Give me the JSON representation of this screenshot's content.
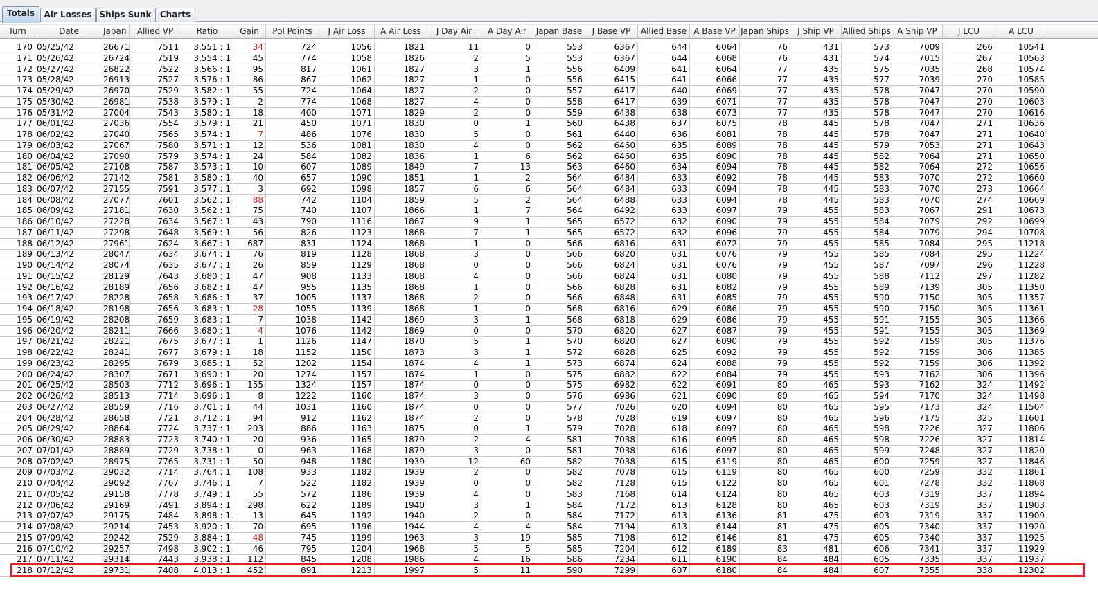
{
  "tabs": [
    {
      "label": "Totals",
      "active": true
    },
    {
      "label": "Air Losses",
      "active": false
    },
    {
      "label": "Ships Sunk",
      "active": false
    },
    {
      "label": "Charts",
      "active": false
    }
  ],
  "columns": [
    "Turn",
    "Date",
    "Japan VP",
    "Allied VP",
    "Ratio",
    "Gain",
    "Pol Points",
    "J Air Loss",
    "A Air Loss",
    "J Day Air",
    "A Day Air",
    "Japan Base",
    "J Base VP",
    "Allied Base",
    "A Base VP",
    "Japan Ships",
    "J Ship VP",
    "Allied Ships",
    "A Ship VP",
    "J LCU",
    "A LCU"
  ],
  "colors": {
    "gain_negative": "#d81b1b",
    "highlight": "#e0202a"
  },
  "rows": [
    [
      "170",
      "05/25/42",
      "26671",
      "7511",
      "3,551 : 1",
      "34",
      "724",
      "1056",
      "1821",
      "11",
      "0",
      "553",
      "6367",
      "644",
      "6064",
      "76",
      "431",
      "573",
      "7009",
      "266",
      "10541"
    ],
    [
      "171",
      "05/26/42",
      "26724",
      "7519",
      "3,554 : 1",
      "45",
      "774",
      "1058",
      "1826",
      "2",
      "5",
      "553",
      "6367",
      "644",
      "6068",
      "76",
      "431",
      "574",
      "7015",
      "267",
      "10563"
    ],
    [
      "172",
      "05/27/42",
      "26822",
      "7522",
      "3,566 : 1",
      "95",
      "817",
      "1061",
      "1827",
      "3",
      "1",
      "556",
      "6409",
      "641",
      "6064",
      "77",
      "435",
      "575",
      "7035",
      "268",
      "10574"
    ],
    [
      "173",
      "05/28/42",
      "26913",
      "7527",
      "3,576 : 1",
      "86",
      "867",
      "1062",
      "1827",
      "1",
      "0",
      "556",
      "6415",
      "641",
      "6066",
      "77",
      "435",
      "577",
      "7039",
      "270",
      "10585"
    ],
    [
      "174",
      "05/29/42",
      "26970",
      "7529",
      "3,582 : 1",
      "55",
      "724",
      "1064",
      "1827",
      "2",
      "0",
      "557",
      "6417",
      "640",
      "6069",
      "77",
      "435",
      "578",
      "7047",
      "270",
      "10590"
    ],
    [
      "175",
      "05/30/42",
      "26981",
      "7538",
      "3,579 : 1",
      "2",
      "774",
      "1068",
      "1827",
      "4",
      "0",
      "558",
      "6417",
      "639",
      "6071",
      "77",
      "435",
      "578",
      "7047",
      "270",
      "10603"
    ],
    [
      "176",
      "05/31/42",
      "27004",
      "7543",
      "3,580 : 1",
      "18",
      "400",
      "1071",
      "1829",
      "2",
      "0",
      "559",
      "6438",
      "638",
      "6073",
      "77",
      "435",
      "578",
      "7047",
      "270",
      "10616"
    ],
    [
      "177",
      "06/01/42",
      "27036",
      "7554",
      "3,579 : 1",
      "21",
      "450",
      "1071",
      "1830",
      "0",
      "1",
      "560",
      "6438",
      "637",
      "6075",
      "78",
      "445",
      "578",
      "7047",
      "271",
      "10636"
    ],
    [
      "178",
      "06/02/42",
      "27040",
      "7565",
      "3,574 : 1",
      "7",
      "486",
      "1076",
      "1830",
      "5",
      "0",
      "561",
      "6440",
      "636",
      "6081",
      "78",
      "445",
      "578",
      "7047",
      "271",
      "10640"
    ],
    [
      "179",
      "06/03/42",
      "27067",
      "7580",
      "3,571 : 1",
      "12",
      "536",
      "1081",
      "1830",
      "4",
      "0",
      "562",
      "6460",
      "635",
      "6089",
      "78",
      "445",
      "579",
      "7053",
      "271",
      "10643"
    ],
    [
      "180",
      "06/04/42",
      "27090",
      "7579",
      "3,574 : 1",
      "24",
      "584",
      "1082",
      "1836",
      "1",
      "6",
      "562",
      "6460",
      "635",
      "6090",
      "78",
      "445",
      "582",
      "7064",
      "271",
      "10650"
    ],
    [
      "181",
      "06/05/42",
      "27108",
      "7587",
      "3,573 : 1",
      "10",
      "607",
      "1089",
      "1849",
      "7",
      "13",
      "563",
      "6460",
      "634",
      "6094",
      "78",
      "445",
      "582",
      "7064",
      "272",
      "10656"
    ],
    [
      "182",
      "06/06/42",
      "27142",
      "7581",
      "3,580 : 1",
      "40",
      "657",
      "1090",
      "1851",
      "1",
      "2",
      "564",
      "6484",
      "633",
      "6092",
      "78",
      "445",
      "583",
      "7070",
      "272",
      "10660"
    ],
    [
      "183",
      "06/07/42",
      "27155",
      "7591",
      "3,577 : 1",
      "3",
      "692",
      "1098",
      "1857",
      "6",
      "6",
      "564",
      "6484",
      "633",
      "6094",
      "78",
      "445",
      "583",
      "7070",
      "273",
      "10664"
    ],
    [
      "184",
      "06/08/42",
      "27077",
      "7601",
      "3,562 : 1",
      "88",
      "742",
      "1104",
      "1859",
      "5",
      "2",
      "564",
      "6488",
      "633",
      "6094",
      "78",
      "445",
      "583",
      "7070",
      "274",
      "10669"
    ],
    [
      "185",
      "06/09/42",
      "27181",
      "7630",
      "3,562 : 1",
      "75",
      "740",
      "1107",
      "1866",
      "1",
      "7",
      "564",
      "6492",
      "633",
      "6097",
      "79",
      "455",
      "583",
      "7067",
      "291",
      "10673"
    ],
    [
      "186",
      "06/10/42",
      "27228",
      "7634",
      "3,567 : 1",
      "43",
      "790",
      "1116",
      "1867",
      "9",
      "1",
      "565",
      "6572",
      "632",
      "6090",
      "79",
      "455",
      "584",
      "7079",
      "292",
      "10699"
    ],
    [
      "187",
      "06/11/42",
      "27298",
      "7648",
      "3,569 : 1",
      "56",
      "826",
      "1123",
      "1868",
      "7",
      "1",
      "565",
      "6572",
      "632",
      "6096",
      "79",
      "455",
      "584",
      "7079",
      "294",
      "10708"
    ],
    [
      "188",
      "06/12/42",
      "27961",
      "7624",
      "3,667 : 1",
      "687",
      "831",
      "1124",
      "1868",
      "1",
      "0",
      "566",
      "6816",
      "631",
      "6072",
      "79",
      "455",
      "585",
      "7084",
      "295",
      "11218"
    ],
    [
      "189",
      "06/13/42",
      "28047",
      "7634",
      "3,674 : 1",
      "76",
      "819",
      "1128",
      "1868",
      "3",
      "0",
      "566",
      "6820",
      "631",
      "6076",
      "79",
      "455",
      "585",
      "7084",
      "295",
      "11224"
    ],
    [
      "190",
      "06/14/42",
      "28074",
      "7635",
      "3,677 : 1",
      "26",
      "859",
      "1129",
      "1868",
      "0",
      "0",
      "566",
      "6824",
      "631",
      "6076",
      "79",
      "455",
      "587",
      "7097",
      "296",
      "11228"
    ],
    [
      "191",
      "06/15/42",
      "28129",
      "7643",
      "3,680 : 1",
      "47",
      "908",
      "1133",
      "1868",
      "4",
      "0",
      "566",
      "6824",
      "631",
      "6080",
      "79",
      "455",
      "588",
      "7112",
      "297",
      "11282"
    ],
    [
      "192",
      "06/16/42",
      "28189",
      "7656",
      "3,682 : 1",
      "47",
      "955",
      "1135",
      "1868",
      "1",
      "0",
      "566",
      "6828",
      "631",
      "6082",
      "79",
      "455",
      "589",
      "7139",
      "305",
      "11350"
    ],
    [
      "193",
      "06/17/42",
      "28228",
      "7658",
      "3,686 : 1",
      "37",
      "1005",
      "1137",
      "1868",
      "2",
      "0",
      "566",
      "6848",
      "631",
      "6085",
      "79",
      "455",
      "590",
      "7150",
      "305",
      "11357"
    ],
    [
      "194",
      "06/18/42",
      "28198",
      "7656",
      "3,683 : 1",
      "28",
      "1055",
      "1139",
      "1868",
      "1",
      "0",
      "568",
      "6816",
      "629",
      "6086",
      "79",
      "455",
      "590",
      "7150",
      "305",
      "11361"
    ],
    [
      "195",
      "06/19/42",
      "28208",
      "7659",
      "3,683 : 1",
      "7",
      "1038",
      "1142",
      "1869",
      "3",
      "1",
      "568",
      "6818",
      "629",
      "6086",
      "79",
      "455",
      "591",
      "7155",
      "305",
      "11366"
    ],
    [
      "196",
      "06/20/42",
      "28211",
      "7666",
      "3,680 : 1",
      "4",
      "1076",
      "1142",
      "1869",
      "0",
      "0",
      "570",
      "6820",
      "627",
      "6087",
      "79",
      "455",
      "591",
      "7155",
      "305",
      "11369"
    ],
    [
      "197",
      "06/21/42",
      "28221",
      "7675",
      "3,677 : 1",
      "1",
      "1126",
      "1147",
      "1870",
      "5",
      "1",
      "570",
      "6820",
      "627",
      "6090",
      "79",
      "455",
      "592",
      "7159",
      "305",
      "11376"
    ],
    [
      "198",
      "06/22/42",
      "28241",
      "7677",
      "3,679 : 1",
      "18",
      "1152",
      "1150",
      "1873",
      "3",
      "1",
      "572",
      "6828",
      "625",
      "6092",
      "79",
      "455",
      "592",
      "7159",
      "306",
      "11385"
    ],
    [
      "199",
      "06/23/42",
      "28295",
      "7679",
      "3,685 : 1",
      "52",
      "1202",
      "1154",
      "1874",
      "4",
      "1",
      "573",
      "6874",
      "624",
      "6088",
      "79",
      "455",
      "592",
      "7159",
      "306",
      "11392"
    ],
    [
      "200",
      "06/24/42",
      "28307",
      "7671",
      "3,690 : 1",
      "20",
      "1274",
      "1157",
      "1874",
      "1",
      "0",
      "575",
      "6882",
      "622",
      "6084",
      "79",
      "455",
      "593",
      "7162",
      "306",
      "11396"
    ],
    [
      "201",
      "06/25/42",
      "28503",
      "7712",
      "3,696 : 1",
      "155",
      "1324",
      "1157",
      "1874",
      "0",
      "0",
      "575",
      "6982",
      "622",
      "6091",
      "80",
      "465",
      "593",
      "7162",
      "324",
      "11492"
    ],
    [
      "202",
      "06/26/42",
      "28513",
      "7714",
      "3,696 : 1",
      "8",
      "1222",
      "1160",
      "1874",
      "3",
      "0",
      "576",
      "6986",
      "621",
      "6090",
      "80",
      "465",
      "594",
      "7170",
      "324",
      "11498"
    ],
    [
      "203",
      "06/27/42",
      "28559",
      "7716",
      "3,701 : 1",
      "44",
      "1031",
      "1160",
      "1874",
      "0",
      "0",
      "577",
      "7026",
      "620",
      "6094",
      "80",
      "465",
      "595",
      "7173",
      "324",
      "11504"
    ],
    [
      "204",
      "06/28/42",
      "28658",
      "7721",
      "3,712 : 1",
      "94",
      "912",
      "1162",
      "1874",
      "2",
      "0",
      "578",
      "7028",
      "619",
      "6097",
      "80",
      "465",
      "596",
      "7175",
      "325",
      "11601"
    ],
    [
      "205",
      "06/29/42",
      "28864",
      "7724",
      "3,737 : 1",
      "203",
      "886",
      "1163",
      "1875",
      "0",
      "1",
      "579",
      "7028",
      "618",
      "6097",
      "80",
      "465",
      "598",
      "7226",
      "327",
      "11806"
    ],
    [
      "206",
      "06/30/42",
      "28883",
      "7723",
      "3,740 : 1",
      "20",
      "936",
      "1165",
      "1879",
      "2",
      "4",
      "581",
      "7038",
      "616",
      "6095",
      "80",
      "465",
      "598",
      "7226",
      "327",
      "11814"
    ],
    [
      "207",
      "07/01/42",
      "28889",
      "7729",
      "3,738 : 1",
      "0",
      "963",
      "1168",
      "1879",
      "3",
      "0",
      "581",
      "7038",
      "616",
      "6097",
      "80",
      "465",
      "599",
      "7248",
      "327",
      "11820"
    ],
    [
      "208",
      "07/02/42",
      "28975",
      "7765",
      "3,731 : 1",
      "50",
      "948",
      "1180",
      "1939",
      "12",
      "60",
      "582",
      "7038",
      "615",
      "6119",
      "80",
      "465",
      "600",
      "7259",
      "327",
      "11846"
    ],
    [
      "209",
      "07/03/42",
      "29032",
      "7714",
      "3,764 : 1",
      "108",
      "933",
      "1182",
      "1939",
      "2",
      "0",
      "582",
      "7078",
      "615",
      "6119",
      "80",
      "465",
      "600",
      "7259",
      "332",
      "11861"
    ],
    [
      "210",
      "07/04/42",
      "29092",
      "7767",
      "3,746 : 1",
      "7",
      "522",
      "1182",
      "1939",
      "0",
      "0",
      "582",
      "7128",
      "615",
      "6122",
      "80",
      "465",
      "601",
      "7278",
      "332",
      "11868"
    ],
    [
      "211",
      "07/05/42",
      "29158",
      "7778",
      "3,749 : 1",
      "55",
      "572",
      "1186",
      "1939",
      "4",
      "0",
      "583",
      "7168",
      "614",
      "6124",
      "80",
      "465",
      "603",
      "7319",
      "337",
      "11894"
    ],
    [
      "212",
      "07/06/42",
      "29169",
      "7491",
      "3,894 : 1",
      "298",
      "622",
      "1189",
      "1940",
      "3",
      "1",
      "584",
      "7172",
      "613",
      "6128",
      "80",
      "465",
      "603",
      "7319",
      "337",
      "11903"
    ],
    [
      "213",
      "07/07/42",
      "29175",
      "7484",
      "3,898 : 1",
      "13",
      "645",
      "1192",
      "1940",
      "2",
      "0",
      "584",
      "7172",
      "613",
      "6136",
      "81",
      "475",
      "603",
      "7319",
      "337",
      "11909"
    ],
    [
      "214",
      "07/08/42",
      "29214",
      "7453",
      "3,920 : 1",
      "70",
      "695",
      "1196",
      "1944",
      "4",
      "4",
      "584",
      "7194",
      "613",
      "6144",
      "81",
      "475",
      "605",
      "7340",
      "337",
      "11920"
    ],
    [
      "215",
      "07/09/42",
      "29242",
      "7529",
      "3,884 : 1",
      "48",
      "745",
      "1199",
      "1963",
      "3",
      "19",
      "585",
      "7198",
      "612",
      "6146",
      "81",
      "475",
      "605",
      "7340",
      "337",
      "11925"
    ],
    [
      "216",
      "07/10/42",
      "29257",
      "7498",
      "3,902 : 1",
      "46",
      "795",
      "1204",
      "1968",
      "5",
      "5",
      "585",
      "7204",
      "612",
      "6189",
      "83",
      "481",
      "606",
      "7341",
      "337",
      "11929"
    ],
    [
      "217",
      "07/11/42",
      "29314",
      "7443",
      "3,938 : 1",
      "112",
      "845",
      "1208",
      "1986",
      "4",
      "16",
      "586",
      "7234",
      "611",
      "6190",
      "84",
      "484",
      "605",
      "7335",
      "337",
      "11937"
    ],
    [
      "218",
      "07/12/42",
      "29731",
      "7408",
      "4,013 : 1",
      "452",
      "891",
      "1213",
      "1997",
      "5",
      "11",
      "590",
      "7299",
      "607",
      "6180",
      "84",
      "484",
      "607",
      "7355",
      "338",
      "12302"
    ]
  ],
  "negative_gain_turns": [
    "170",
    "178",
    "184",
    "194",
    "196",
    "215"
  ]
}
